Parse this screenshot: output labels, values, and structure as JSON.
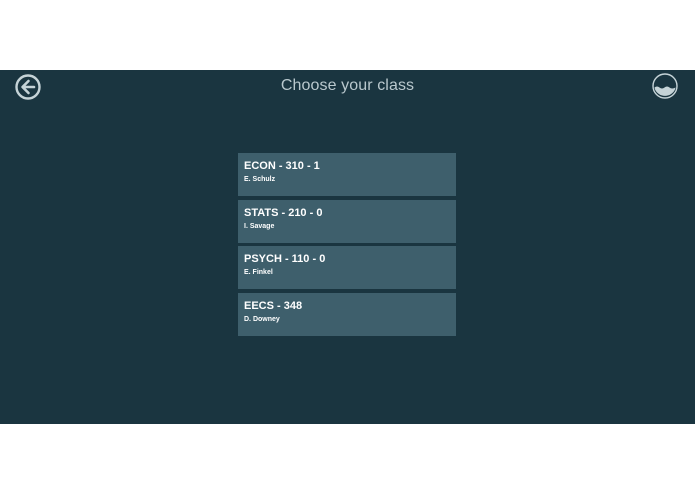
{
  "header": {
    "title": "Choose your class",
    "back_icon": "back-arrow-icon",
    "logo_icon": "wave-logo-icon"
  },
  "colors": {
    "background": "#1a3540",
    "card": "#3e5f6c",
    "title_text": "#b9c8cd",
    "icon": "#c5d3d7"
  },
  "classes": [
    {
      "name": "ECON - 310 - 1",
      "teacher": "E. Schulz"
    },
    {
      "name": "STATS - 210 - 0",
      "teacher": "I. Savage"
    },
    {
      "name": "PSYCH - 110 - 0",
      "teacher": "E. Finkel"
    },
    {
      "name": "EECS - 348",
      "teacher": "D. Downey"
    }
  ]
}
